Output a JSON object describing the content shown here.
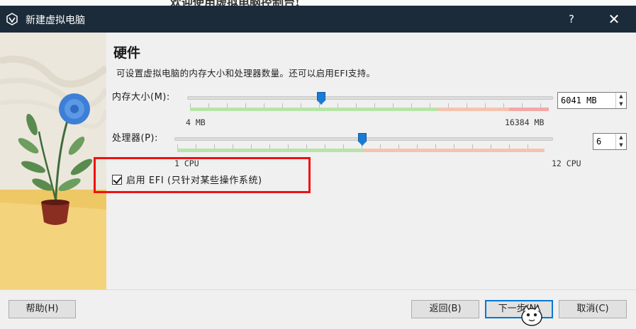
{
  "background_window": {
    "partial_title": "欢迎使用虚拟电脑控制台!"
  },
  "window": {
    "title": "新建虚拟电脑",
    "help_glyph": "?",
    "close_glyph": "✕"
  },
  "page": {
    "heading": "硬件",
    "description": "可设置虚拟电脑的内存大小和处理器数量。还可以启用EFI支持。"
  },
  "memory": {
    "label": "内存大小(M):",
    "min_label": "4 MB",
    "max_label": "16384 MB",
    "value": "6041 MB",
    "slider_fraction": 0.37
  },
  "cpu": {
    "label": "处理器(P):",
    "min_label": "1 CPU",
    "max_label": "12 CPU",
    "value": "6",
    "slider_fraction": 0.455
  },
  "efi": {
    "label": "启用 EFI (只针对某些操作系统)",
    "checked": true
  },
  "buttons": {
    "help": "帮助(H)",
    "back": "返回(B)",
    "next": "下一步(N)",
    "cancel": "取消(C)"
  },
  "colors": {
    "titlebar": "#1c2b3a",
    "accent": "#1a7bd4",
    "highlight": "#ee1111",
    "range_ok": "#b7e4a8",
    "range_warn": "#f4c4b0",
    "range_bad": "#f3a8a8"
  },
  "icons": [
    "virtualbox-icon",
    "help-icon",
    "close-icon",
    "checkmark-icon",
    "spin-up-icon",
    "spin-down-icon",
    "plant-illustration",
    "mascot-cursor-icon"
  ]
}
